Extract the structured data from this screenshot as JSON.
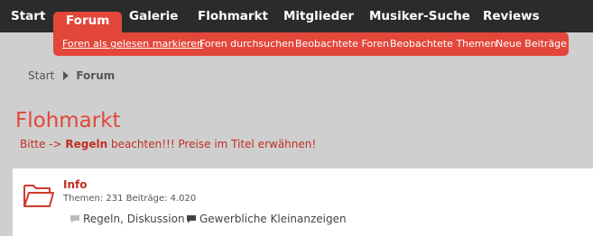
{
  "nav": {
    "tabs": [
      {
        "label": "Start"
      },
      {
        "label": "Forum",
        "active": true
      },
      {
        "label": "Galerie"
      },
      {
        "label": "Flohmarkt"
      },
      {
        "label": "Mitglieder"
      },
      {
        "label": "Musiker-Suche"
      },
      {
        "label": "Reviews"
      }
    ],
    "subnav": [
      {
        "label": "Foren als gelesen markieren"
      },
      {
        "label": "Foren durchsuchen"
      },
      {
        "label": "Beobachtete Foren"
      },
      {
        "label": "Beobachtete Themen"
      },
      {
        "label": "Neue Beiträge"
      }
    ]
  },
  "breadcrumb": {
    "start": "Start",
    "current": "Forum"
  },
  "page": {
    "title": "Flohmarkt",
    "desc_prefix": "Bitte -> ",
    "desc_bold": "Regeln",
    "desc_suffix": " beachten!!! Preise im Titel erwähnen!"
  },
  "forum": {
    "title": "Info",
    "stats": "Themen: 231 Beiträge: 4.020",
    "subforums": [
      {
        "label": "Regeln, Diskussion",
        "icon": "speech-bubble-grey-icon"
      },
      {
        "label": "Gewerbliche Kleinanzeigen",
        "icon": "speech-bubble-dark-icon"
      }
    ]
  },
  "colors": {
    "accent": "#e2473a",
    "nav_bg": "#2b2b2b",
    "page_bg": "#cfcfcf",
    "title_red": "#c22e22"
  }
}
